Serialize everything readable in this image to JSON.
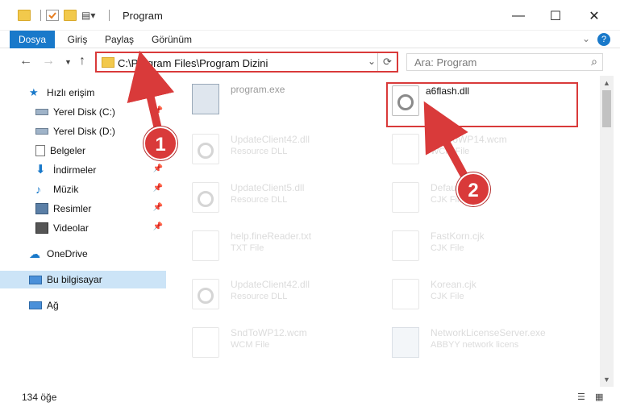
{
  "window": {
    "title": "Program",
    "minimize_icon": "minimize-icon",
    "maximize_icon": "maximize-icon",
    "close_icon": "close-icon"
  },
  "ribbon": {
    "tabs": [
      "Dosya",
      "Giriş",
      "Paylaş",
      "Görünüm"
    ],
    "expand_glyph": "⌄",
    "help_label": "?"
  },
  "address": {
    "path": "C:\\Program Files\\Program Dizini",
    "refresh_glyph": "⟳"
  },
  "search": {
    "placeholder": "Ara: Program"
  },
  "sidebar": {
    "items": [
      {
        "label": "Hızlı erişim",
        "icon": "star-icon",
        "pinned": false
      },
      {
        "label": "Yerel Disk (C:)",
        "icon": "drive-icon",
        "pinned": true
      },
      {
        "label": "Yerel Disk (D:)",
        "icon": "drive-icon",
        "pinned": true
      },
      {
        "label": "Belgeler",
        "icon": "documents-icon",
        "pinned": true
      },
      {
        "label": "İndirmeler",
        "icon": "download-icon",
        "pinned": true
      },
      {
        "label": "Müzik",
        "icon": "music-icon",
        "pinned": true
      },
      {
        "label": "Resimler",
        "icon": "pictures-icon",
        "pinned": true
      },
      {
        "label": "Videolar",
        "icon": "videos-icon",
        "pinned": true
      },
      {
        "label": "OneDrive",
        "icon": "cloud-icon",
        "pinned": false
      },
      {
        "label": "Bu bilgisayar",
        "icon": "computer-icon",
        "pinned": false
      },
      {
        "label": "Ağ",
        "icon": "network-icon",
        "pinned": false
      }
    ]
  },
  "files": {
    "items": [
      {
        "name": "program.exe",
        "type": ""
      },
      {
        "name": "a6flash.dll",
        "type": ""
      },
      {
        "name": "UpdateClient42.dll",
        "type": "Resource DLL"
      },
      {
        "name": "SndToWP14.wcm",
        "type": "WCM File"
      },
      {
        "name": "UpdateClient5.dll",
        "type": "Resource DLL"
      },
      {
        "name": "Default.cjk",
        "type": "CJK File"
      },
      {
        "name": "help.fineReader.txt",
        "type": "TXT File"
      },
      {
        "name": "FastKorn.cjk",
        "type": "CJK File"
      },
      {
        "name": "UpdateClient42.dll",
        "type": "Resource DLL"
      },
      {
        "name": "Korean.cjk",
        "type": "CJK File"
      },
      {
        "name": "SndToWP12.wcm",
        "type": "WCM File"
      },
      {
        "name": "NetworkLicenseServer.exe",
        "type": "ABBYY network licens"
      }
    ]
  },
  "steps": [
    "1",
    "2"
  ],
  "status": {
    "count": "134 öğe"
  },
  "colors": {
    "accent": "#1979ca",
    "highlight_red": "#d93a3a",
    "selected_bg": "#cce4f7"
  }
}
